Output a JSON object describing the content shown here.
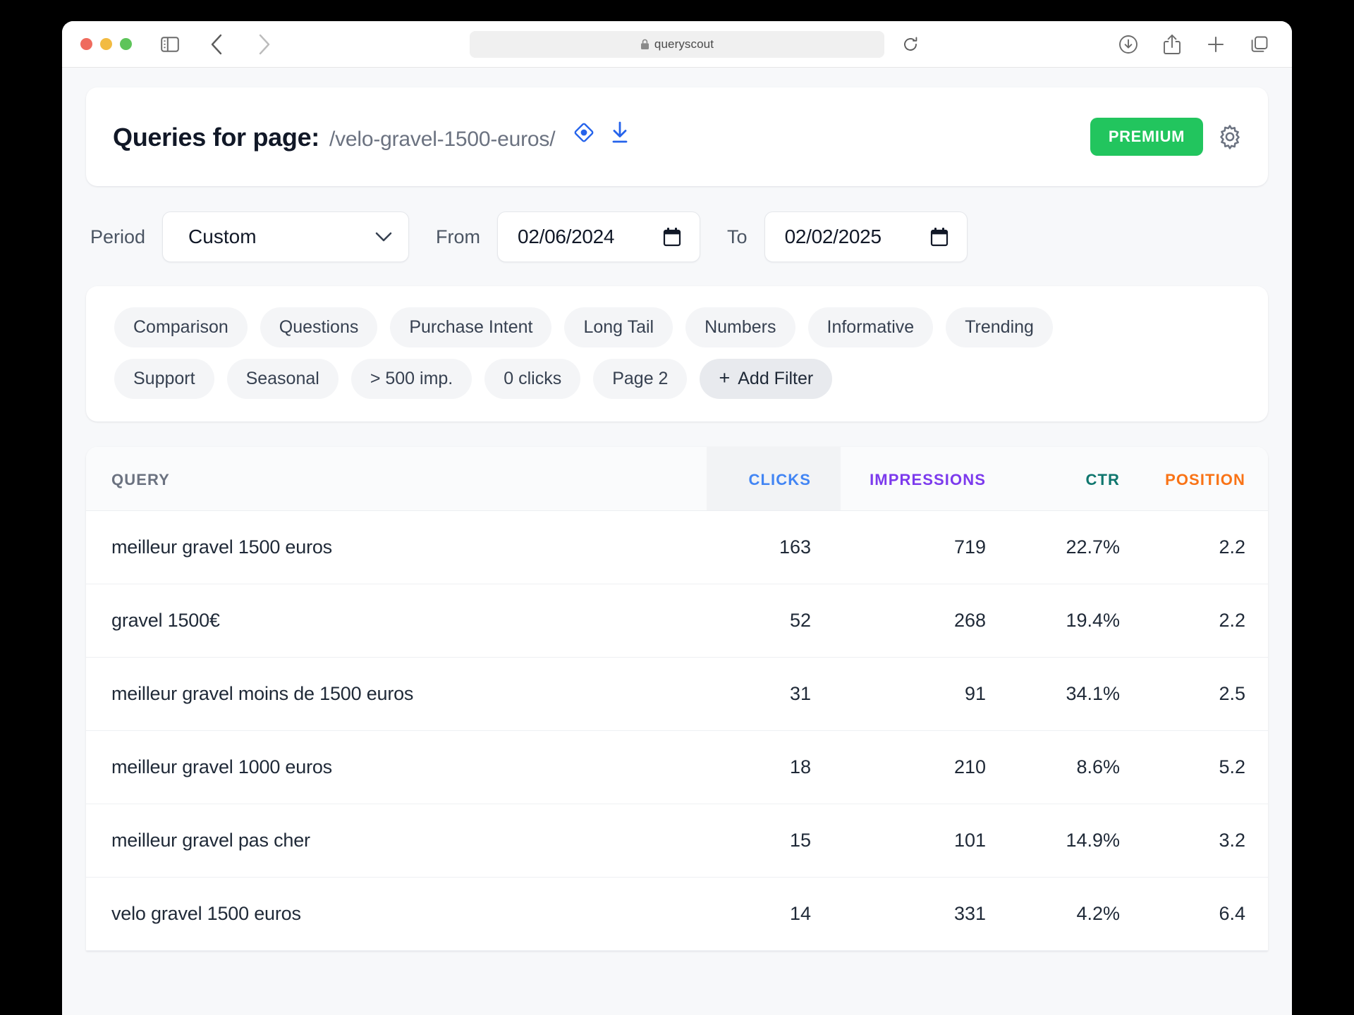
{
  "browser": {
    "url_text": "queryscout",
    "lock_icon": "lock-icon",
    "sidebar_icon": "sidebar-toggle-icon",
    "back_icon": "chevron-left-icon",
    "forward_icon": "chevron-right-icon",
    "shield_icon": "privacy-shield-icon",
    "reload_icon": "reload-icon",
    "downloads_icon": "downloads-icon",
    "share_icon": "share-icon",
    "newtab_icon": "plus-icon",
    "tabs_icon": "tab-overview-icon"
  },
  "header": {
    "title": "Queries for page:",
    "path": "/velo-gravel-1500-euros/",
    "target_icon": "target-diamond-icon",
    "download_icon": "download-icon",
    "premium_label": "PREMIUM",
    "settings_icon": "gear-icon",
    "premium_color": "#22c55e"
  },
  "period": {
    "label": "Period",
    "select_value": "Custom",
    "from_label": "From",
    "from_value": "02/06/2024",
    "to_label": "To",
    "to_value": "02/02/2025",
    "calendar_icon": "calendar-icon",
    "chevron_icon": "chevron-down-icon"
  },
  "filters": {
    "row1": [
      {
        "label": "Comparison"
      },
      {
        "label": "Questions"
      },
      {
        "label": "Purchase Intent"
      },
      {
        "label": "Long Tail"
      },
      {
        "label": "Numbers"
      },
      {
        "label": "Informative"
      },
      {
        "label": "Trending"
      }
    ],
    "row2": [
      {
        "label": "Support"
      },
      {
        "label": "Seasonal"
      },
      {
        "label": "> 500 imp."
      },
      {
        "label": "0 clicks"
      },
      {
        "label": "Page 2"
      }
    ],
    "add_plus": "+",
    "add_label": "Add Filter"
  },
  "table": {
    "columns": [
      {
        "key": "query",
        "label": "QUERY",
        "color": "#6b7280"
      },
      {
        "key": "clicks",
        "label": "CLICKS",
        "color": "#4285f4"
      },
      {
        "key": "impressions",
        "label": "IMPRESSIONS",
        "color": "#7c3aed"
      },
      {
        "key": "ctr",
        "label": "CTR",
        "color": "#0f766e"
      },
      {
        "key": "position",
        "label": "POSITION",
        "color": "#f97316"
      }
    ],
    "rows": [
      {
        "query": "meilleur gravel 1500 euros",
        "clicks": "163",
        "impressions": "719",
        "ctr": "22.7%",
        "position": "2.2"
      },
      {
        "query": "gravel 1500€",
        "clicks": "52",
        "impressions": "268",
        "ctr": "19.4%",
        "position": "2.2"
      },
      {
        "query": "meilleur gravel moins de 1500 euros",
        "clicks": "31",
        "impressions": "91",
        "ctr": "34.1%",
        "position": "2.5"
      },
      {
        "query": "meilleur gravel 1000 euros",
        "clicks": "18",
        "impressions": "210",
        "ctr": "8.6%",
        "position": "5.2"
      },
      {
        "query": "meilleur gravel pas cher",
        "clicks": "15",
        "impressions": "101",
        "ctr": "14.9%",
        "position": "3.2"
      },
      {
        "query": "velo gravel 1500 euros",
        "clicks": "14",
        "impressions": "331",
        "ctr": "4.2%",
        "position": "6.4"
      }
    ]
  }
}
